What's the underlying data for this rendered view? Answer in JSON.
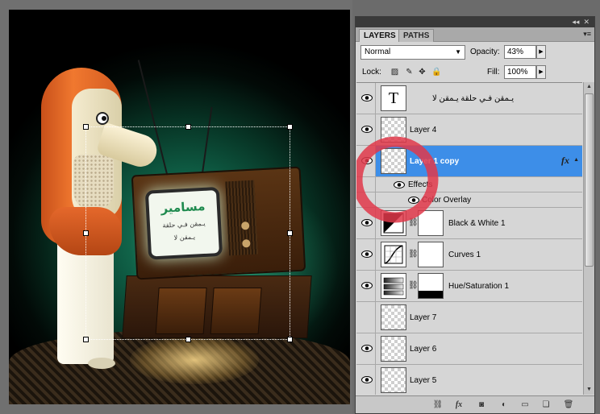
{
  "panel": {
    "collapse_glyph": "◂◂",
    "close_glyph": "✕",
    "menu_glyph": "▾≡",
    "tabs": [
      {
        "label": "LAYERS",
        "active": true
      },
      {
        "label": "PATHS",
        "active": false
      }
    ],
    "blend_mode": "Normal",
    "opacity_label": "Opacity:",
    "opacity_value": "43%",
    "lock_label": "Lock:",
    "fill_label": "Fill:",
    "fill_value": "100%"
  },
  "layers": [
    {
      "name": "يـمقن فـي حلقة  يـمقن لا",
      "type": "text",
      "thumb_glyph": "T",
      "selected": false
    },
    {
      "name": "Layer 4",
      "type": "pixel",
      "selected": false
    },
    {
      "name": "Layer 1 copy",
      "type": "pixel",
      "selected": true,
      "has_fx": true,
      "fx_glyph": "fx",
      "effects_label": "Effects",
      "effects": [
        "Color Overlay"
      ]
    },
    {
      "name": "Black & White 1",
      "type": "adjustment",
      "selected": false
    },
    {
      "name": "Curves 1",
      "type": "adjustment",
      "selected": false
    },
    {
      "name": "Hue/Saturation 1",
      "type": "adjustment",
      "selected": false
    },
    {
      "name": "Layer 7",
      "type": "pixel",
      "selected": false
    },
    {
      "name": "Layer 6",
      "type": "pixel",
      "selected": false
    },
    {
      "name": "Layer 5",
      "type": "pixel",
      "selected": false
    }
  ],
  "canvas": {
    "screen_title": "مسامير",
    "screen_line1": "يـمقن فـي حلقة",
    "screen_line2": "يـمقن لا"
  },
  "colors": {
    "selection_blue": "#3d8ee8",
    "annotation_red": "#e0384a"
  },
  "icons": {
    "eye": "eye-icon",
    "lock_transparent": "lock-transparent-icon",
    "lock_paint": "brush-icon",
    "lock_move": "move-icon",
    "lock_all": "lock-icon",
    "link": "link-icon",
    "fx": "fx-icon",
    "mask": "mask-icon",
    "adjustment": "adjustment-icon",
    "group": "folder-icon",
    "new_layer": "new-layer-icon",
    "delete": "trash-icon"
  }
}
